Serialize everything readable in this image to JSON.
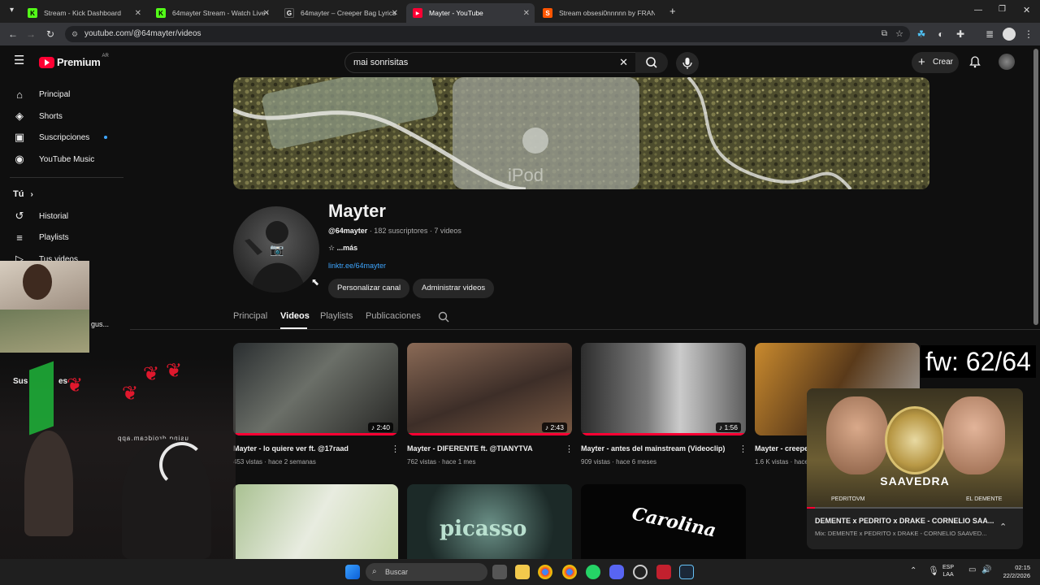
{
  "browser": {
    "tabs": [
      {
        "title": "Stream - Kick Dashboard",
        "fav": "K",
        "color": "#53fc18"
      },
      {
        "title": "64mayter Stream - Watch Live o",
        "fav": "K",
        "color": "#53fc18"
      },
      {
        "title": "64mayter – Creeper Bag Lyrics |",
        "fav": "G",
        "color": "#222222"
      },
      {
        "title": "Mayter - YouTube",
        "fav": "▶",
        "color": "#ff0033"
      },
      {
        "title": "Stream obsesi0nnnnn by FRAN",
        "fav": "S",
        "color": "#ff5500"
      }
    ],
    "url": "youtube.com/@64mayter/videos"
  },
  "header": {
    "logo_text": "Premium",
    "logo_region": "AR",
    "search_value": "mai sonrisitas",
    "create_label": "Crear"
  },
  "sidebar": {
    "items": [
      {
        "label": "Principal",
        "icon": "home-icon",
        "glyph": "⌂"
      },
      {
        "label": "Shorts",
        "icon": "shorts-icon",
        "glyph": "◈"
      },
      {
        "label": "Suscripciones",
        "icon": "subscriptions-icon",
        "glyph": "▣"
      },
      {
        "label": "YouTube Music",
        "icon": "music-icon",
        "glyph": "◉"
      }
    ],
    "you_label": "Tú",
    "you_items": [
      {
        "label": "Historial",
        "icon": "history-icon",
        "glyph": "↺"
      },
      {
        "label": "Playlists",
        "icon": "playlists-icon",
        "glyph": "≡"
      },
      {
        "label": "Tus videos",
        "icon": "your-videos-icon",
        "glyph": "▷"
      }
    ],
    "partial_label": "gus...",
    "subs_section_partial": "Sus",
    "subs_section_partial2": "es"
  },
  "channel": {
    "name": "Mayter",
    "handle": "@64mayter",
    "stats": " · 182 suscriptores · 7 videos",
    "more": "☆ ...más",
    "link": "linktr.ee/64mayter",
    "customize_label": "Personalizar canal",
    "manage_label": "Administrar videos",
    "tabs": [
      "Principal",
      "Videos",
      "Playlists",
      "Publicaciones"
    ],
    "selected_tab": "Videos"
  },
  "videos": [
    {
      "title": "Mayter - lo quiere ver ft. @17raad",
      "views": "453 vistas",
      "age": "hace 2 semanas",
      "duration": "♪ 2:40"
    },
    {
      "title": "Mayter - DIFERENTE ft. @TIANYTVA",
      "views": "762 vistas",
      "age": "hace 1 mes",
      "duration": "♪ 2:43"
    },
    {
      "title": "Mayter - antes del mainstream (Videoclip)",
      "views": "909 vistas",
      "age": "hace 6 meses",
      "duration": "♪ 1:56"
    },
    {
      "title": "Mayter - creepe",
      "views": "1.6 K vistas",
      "age": "hace",
      "duration": ""
    }
  ],
  "row2_thumbs": [
    "",
    "picasso",
    "Carolina"
  ],
  "overlays": {
    "fw_counter": "fw: 62/64",
    "droidcam": "using droidcam.app"
  },
  "miniplayer": {
    "art_title": "SAAVEDRA",
    "art_left": "PEDRITOVM",
    "art_right": "EL DEMENTE",
    "title": "DEMENTE x PEDRITO x DRAKE - CORNELIO SAA...",
    "subtitle": "Mix: DEMENTE x PEDRITO x DRAKE - CORNELIO SAAVED..."
  },
  "taskbar": {
    "search_placeholder": "Buscar",
    "lang": "ESP",
    "lang2": "LAA",
    "time": "02:15",
    "date": "22/2/2026"
  }
}
